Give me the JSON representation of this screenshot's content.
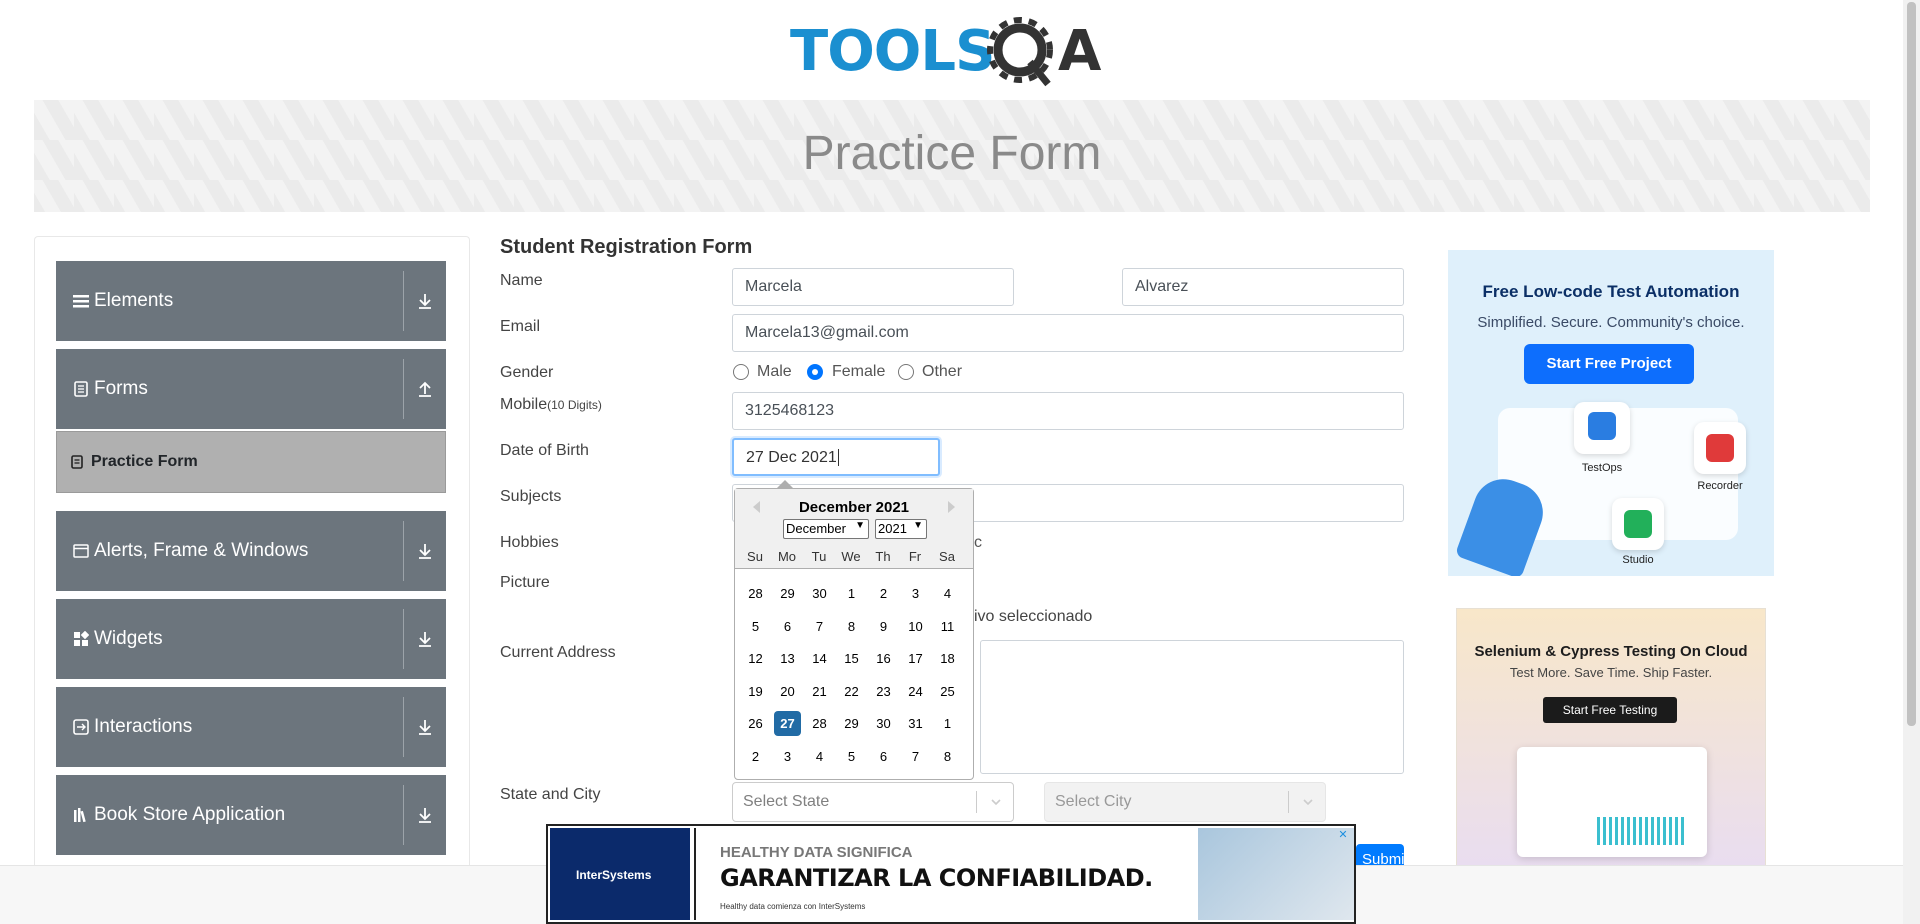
{
  "logo": {
    "text_tools": "TOOLS",
    "text_a": "A"
  },
  "banner": {
    "title": "Practice Form"
  },
  "sidebar": {
    "groups": [
      {
        "label": "Elements"
      },
      {
        "label": "Forms"
      },
      {
        "label": "Alerts, Frame & Windows"
      },
      {
        "label": "Widgets"
      },
      {
        "label": "Interactions"
      },
      {
        "label": "Book Store Application"
      }
    ],
    "active_item": "Practice Form"
  },
  "form": {
    "title": "Student Registration Form",
    "labels": {
      "name": "Name",
      "email": "Email",
      "gender": "Gender",
      "mobile": "Mobile",
      "mobile_hint": "(10 Digits)",
      "dob": "Date of Birth",
      "subjects": "Subjects",
      "hobbies": "Hobbies",
      "picture": "Picture",
      "address": "Current Address",
      "state_city": "State and City"
    },
    "first_name": "Marcela",
    "last_name": "Alvarez",
    "email": "Marcela13@gmail.com",
    "gender_options": [
      "Male",
      "Female",
      "Other"
    ],
    "gender_selected": "Female",
    "mobile": "3125468123",
    "dob": "27 Dec 2021",
    "hobby_partial": "c",
    "file_status_partial": "ivo seleccionado",
    "state_placeholder": "Select State",
    "city_placeholder": "Select City",
    "submit_label": "Submit"
  },
  "calendar": {
    "month_title": "December 2021",
    "month_select": "December",
    "year_select": "2021",
    "weekdays": [
      "Su",
      "Mo",
      "Tu",
      "We",
      "Th",
      "Fr",
      "Sa"
    ],
    "weeks": [
      [
        "28",
        "29",
        "30",
        "1",
        "2",
        "3",
        "4"
      ],
      [
        "5",
        "6",
        "7",
        "8",
        "9",
        "10",
        "11"
      ],
      [
        "12",
        "13",
        "14",
        "15",
        "16",
        "17",
        "18"
      ],
      [
        "19",
        "20",
        "21",
        "22",
        "23",
        "24",
        "25"
      ],
      [
        "26",
        "27",
        "28",
        "29",
        "30",
        "31",
        "1"
      ],
      [
        "2",
        "3",
        "4",
        "5",
        "6",
        "7",
        "8"
      ]
    ],
    "selected_day": "27"
  },
  "ads": {
    "ad1": {
      "title": "Free Low-code Test Automation",
      "subtitle": "Simplified. Secure. Community's choice.",
      "button": "Start Free Project",
      "tile_labels": [
        "TestOps",
        "Recorder",
        "Studio"
      ]
    },
    "ad2": {
      "title": "Selenium & Cypress Testing On Cloud",
      "subtitle": "Test More. Save Time. Ship Faster.",
      "button": "Start Free Testing"
    },
    "ad3": {
      "brand": "InterSystems",
      "small": "HEALTHY DATA SIGNIFICA",
      "big": "GARANTIZAR LA CONFIABILIDAD.",
      "foot": "Healthy data comienza con InterSystems"
    }
  }
}
